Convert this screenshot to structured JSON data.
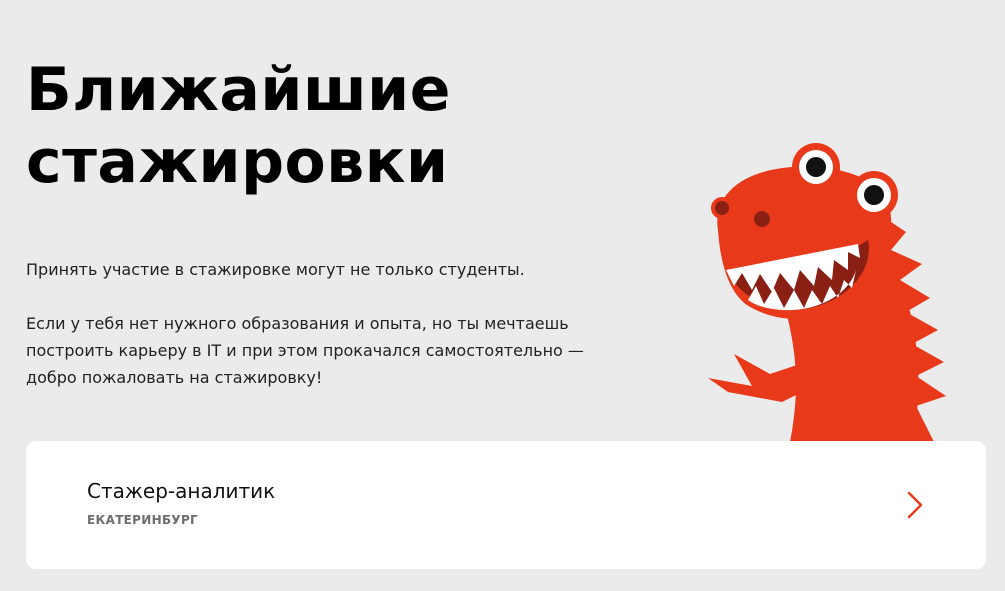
{
  "hero": {
    "title_line1": "Ближайшие",
    "title_line2": "стажировки"
  },
  "intro": {
    "paragraph1": "Принять участие в стажировке могут не только студенты.",
    "paragraph2_line1": "Если у тебя нет нужного образования и опыта, но ты мечтаешь",
    "paragraph2_line2": "построить карьеру в IT и при этом прокачался самостоятельно —",
    "paragraph2_line3": "добро пожаловать на стажировку!"
  },
  "mascot": {
    "icon": "red-dinosaur-mascot",
    "color": "#e8391a"
  },
  "vacancies": [
    {
      "title": "Стажер-аналитик",
      "city": "ЕКАТЕРИНБУРГ",
      "icon": "chevron-right-icon"
    }
  ],
  "colors": {
    "background": "#ebebeb",
    "accent": "#e8391a",
    "card": "#ffffff"
  }
}
